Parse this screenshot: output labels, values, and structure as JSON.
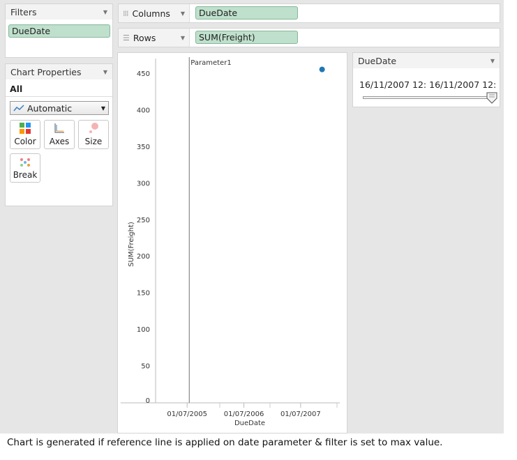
{
  "filters": {
    "title": "Filters",
    "pill": "DueDate"
  },
  "chart_properties": {
    "title": "Chart Properties",
    "scope": "All",
    "mark_type": "Automatic",
    "buttons": [
      {
        "label": "Color",
        "icon": "color-icon"
      },
      {
        "label": "Axes",
        "icon": "axes-icon"
      },
      {
        "label": "Size",
        "icon": "size-icon"
      },
      {
        "label": "Break",
        "icon": "break-icon"
      }
    ]
  },
  "shelves": {
    "columns": {
      "label": "Columns",
      "pill": "DueDate"
    },
    "rows": {
      "label": "Rows",
      "pill": "SUM(Freight)"
    }
  },
  "date_filter": {
    "title": "DueDate",
    "range_text": "16/11/2007 12: 16/11/2007 12:",
    "slider_position": 1.0
  },
  "chart_data": {
    "type": "scatter",
    "title": "",
    "xlabel": "DueDate",
    "ylabel": "SUM(Freight)",
    "ylim": [
      0,
      470
    ],
    "y_ticks": [
      0,
      50,
      100,
      150,
      200,
      250,
      300,
      350,
      400,
      450
    ],
    "x_ticks": [
      "01/07/2005",
      "01/07/2006",
      "01/07/2007"
    ],
    "xlim": [
      "2005-03-01",
      "2008-01-15"
    ],
    "points": [
      {
        "x": "2007-11-16",
        "y": 457
      }
    ],
    "reference_line": {
      "label": "Parameter1",
      "x": "2005-07-15"
    },
    "grid": false,
    "point_color": "#1f77b4"
  },
  "caption": "Chart is generated if reference line is applied on date parameter & filter is set to max value."
}
